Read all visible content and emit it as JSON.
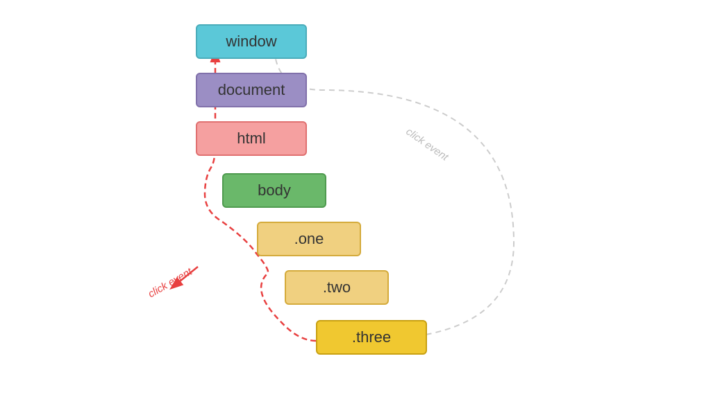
{
  "nodes": {
    "window": {
      "label": "window"
    },
    "document": {
      "label": "document"
    },
    "html": {
      "label": "html"
    },
    "body": {
      "label": "body"
    },
    "one": {
      "label": ".one"
    },
    "two": {
      "label": ".two"
    },
    "three": {
      "label": ".three"
    }
  },
  "labels": {
    "click_event_gray": "click event",
    "click_event_red": "click event"
  }
}
